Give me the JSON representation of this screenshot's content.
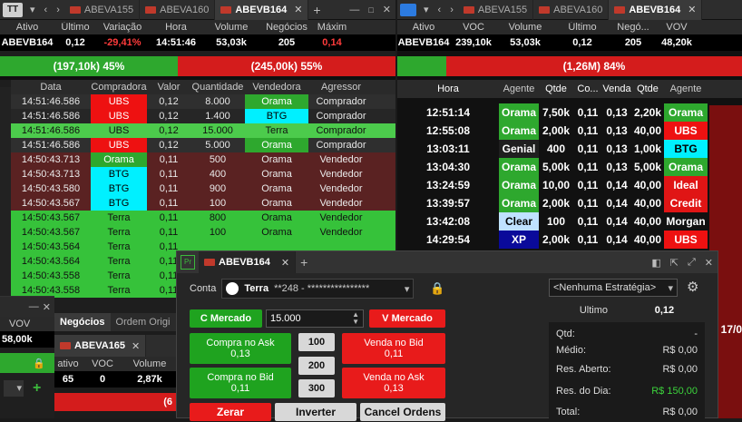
{
  "left_window": {
    "tabs": [
      {
        "label": "ABEVA155",
        "active": false
      },
      {
        "label": "ABEVA160",
        "active": false
      },
      {
        "label": "ABEVB164",
        "active": true
      }
    ],
    "quote_headers": [
      "Ativo",
      "Último",
      "Variação",
      "Hora",
      "Volume",
      "Negócios",
      "Máxim"
    ],
    "quote_values": [
      "ABEVB164",
      "0,12",
      "-29,41%",
      "14:51:46",
      "53,03k",
      "205",
      "0,14"
    ],
    "buy_pressure": "(197,10k) 45%",
    "sell_pressure": "(245,00k) 55%",
    "trade_headers": [
      "Data",
      "Compradora",
      "Valor",
      "Quantidade",
      "Vendedora",
      "Agressor"
    ],
    "trades": [
      {
        "data": "14:51:46.586",
        "comp": "UBS",
        "valor": "0,12",
        "qtd": "8.000",
        "vend": "Orama",
        "agr": "Comprador",
        "rowtype": "buy",
        "comp_style": "ubs",
        "vend_style": "orama"
      },
      {
        "data": "14:51:46.586",
        "comp": "UBS",
        "valor": "0,12",
        "qtd": "1.400",
        "vend": "BTG",
        "agr": "Comprador",
        "rowtype": "buy2",
        "comp_style": "ubs",
        "vend_style": "btg"
      },
      {
        "data": "14:51:46.586",
        "comp": "UBS",
        "valor": "0,12",
        "qtd": "15.000",
        "vend": "Terra",
        "agr": "Comprador",
        "rowtype": "terra2",
        "comp_style": "",
        "vend_style": ""
      },
      {
        "data": "14:51:46.586",
        "comp": "UBS",
        "valor": "0,12",
        "qtd": "5.000",
        "vend": "Orama",
        "agr": "Comprador",
        "rowtype": "buy",
        "comp_style": "ubs",
        "vend_style": "orama"
      },
      {
        "data": "14:50:43.713",
        "comp": "Orama",
        "valor": "0,11",
        "qtd": "500",
        "vend": "Orama",
        "agr": "Vendedor",
        "rowtype": "sell",
        "comp_style": "orama",
        "vend_style": ""
      },
      {
        "data": "14:50:43.713",
        "comp": "BTG",
        "valor": "0,11",
        "qtd": "400",
        "vend": "Orama",
        "agr": "Vendedor",
        "rowtype": "sell",
        "comp_style": "btg",
        "vend_style": ""
      },
      {
        "data": "14:50:43.580",
        "comp": "BTG",
        "valor": "0,11",
        "qtd": "900",
        "vend": "Orama",
        "agr": "Vendedor",
        "rowtype": "sell",
        "comp_style": "btg",
        "vend_style": ""
      },
      {
        "data": "14:50:43.567",
        "comp": "BTG",
        "valor": "0,11",
        "qtd": "100",
        "vend": "Orama",
        "agr": "Vendedor",
        "rowtype": "sell",
        "comp_style": "btg",
        "vend_style": ""
      },
      {
        "data": "14:50:43.567",
        "comp": "Terra",
        "valor": "0,11",
        "qtd": "800",
        "vend": "Orama",
        "agr": "Vendedor",
        "rowtype": "terra",
        "comp_style": "",
        "vend_style": ""
      },
      {
        "data": "14:50:43.567",
        "comp": "Terra",
        "valor": "0,11",
        "qtd": "100",
        "vend": "Orama",
        "agr": "Vendedor",
        "rowtype": "terra",
        "comp_style": "",
        "vend_style": ""
      },
      {
        "data": "14:50:43.564",
        "comp": "Terra",
        "valor": "0,11",
        "qtd": "",
        "vend": "",
        "agr": "",
        "rowtype": "terra",
        "comp_style": "",
        "vend_style": ""
      },
      {
        "data": "14:50:43.564",
        "comp": "Terra",
        "valor": "0,11",
        "qtd": "",
        "vend": "",
        "agr": "",
        "rowtype": "terra",
        "comp_style": "",
        "vend_style": ""
      },
      {
        "data": "14:50:43.558",
        "comp": "Terra",
        "valor": "0,11",
        "qtd": "",
        "vend": "",
        "agr": "",
        "rowtype": "terra",
        "comp_style": "",
        "vend_style": ""
      },
      {
        "data": "14:50:43.558",
        "comp": "Terra",
        "valor": "0,11",
        "qtd": "",
        "vend": "",
        "agr": "",
        "rowtype": "terra",
        "comp_style": "",
        "vend_style": ""
      }
    ]
  },
  "right_window": {
    "tabs": [
      {
        "label": "ABEVA155",
        "active": false
      },
      {
        "label": "ABEVA160",
        "active": false
      },
      {
        "label": "ABEVB164",
        "active": true
      }
    ],
    "quote_headers": [
      "Ativo",
      "VOC",
      "Volume",
      "Último",
      "Negó...",
      "VOV"
    ],
    "quote_values": [
      "ABEVB164",
      "239,10k",
      "53,03k",
      "0,12",
      "205",
      "48,20k"
    ],
    "pressure": "(1,26M) 84%",
    "book_headers": [
      "Hora",
      "Agente",
      "Qtde",
      "Co...",
      "Venda",
      "Qtde",
      "Agente"
    ],
    "book": [
      {
        "hora": "12:51:14",
        "ag": "Orama",
        "qt": "7,50k",
        "co": "0,11",
        "ve": "0,13",
        "qt2": "2,20k",
        "ag2": "Orama",
        "ag_style": "orama",
        "ag2_style": "orama"
      },
      {
        "hora": "12:55:08",
        "ag": "Orama",
        "qt": "2,00k",
        "co": "0,11",
        "ve": "0,13",
        "qt2": "40,00",
        "ag2": "UBS",
        "ag_style": "orama",
        "ag2_style": "ubs"
      },
      {
        "hora": "13:03:11",
        "ag": "Genial",
        "qt": "400",
        "co": "0,11",
        "ve": "0,13",
        "qt2": "1,00k",
        "ag2": "BTG",
        "ag_style": "genial",
        "ag2_style": "btg"
      },
      {
        "hora": "13:04:30",
        "ag": "Orama",
        "qt": "5,00k",
        "co": "0,11",
        "ve": "0,13",
        "qt2": "5,00k",
        "ag2": "Orama",
        "ag_style": "orama",
        "ag2_style": "orama"
      },
      {
        "hora": "13:24:59",
        "ag": "Orama",
        "qt": "10,00",
        "co": "0,11",
        "ve": "0,14",
        "qt2": "40,00",
        "ag2": "Ideal",
        "ag_style": "orama",
        "ag2_style": "ideal"
      },
      {
        "hora": "13:39:57",
        "ag": "Orama",
        "qt": "2,00k",
        "co": "0,11",
        "ve": "0,14",
        "qt2": "40,00",
        "ag2": "Credit",
        "ag_style": "orama",
        "ag2_style": "credit"
      },
      {
        "hora": "13:42:08",
        "ag": "Clear",
        "qt": "100",
        "co": "0,11",
        "ve": "0,14",
        "qt2": "40,00",
        "ag2": "Morgan",
        "ag_style": "clear",
        "ag2_style": "morgan"
      },
      {
        "hora": "14:29:54",
        "ag": "XP",
        "qt": "2,00k",
        "co": "0,11",
        "ve": "0,14",
        "qt2": "40,00",
        "ag2": "UBS",
        "ag_style": "xp",
        "ag2_style": "ubs"
      }
    ],
    "edge_label": "17/0"
  },
  "small_window": {
    "vov_label": "VOV",
    "vov_value": "58,00k",
    "tabs": [
      "Negócios",
      "Ordem Origi"
    ],
    "sub_tab": "ABEVA165",
    "sub_headers": [
      "ativo",
      "VOC",
      "Volume"
    ],
    "sub_values": [
      "65",
      "0",
      "2,87k"
    ],
    "sub_footer": "(6"
  },
  "order_window": {
    "tab_label": "ABEVB164",
    "conta_label": "Conta",
    "account_broker": "Terra",
    "account_number": "**248 - ****************",
    "strategy": "<Nenhuma Estratégia>",
    "c_mercado": "C Mercado",
    "quantity": "15.000",
    "v_mercado": "V Mercado",
    "compra_ask_label": "Compra no Ask",
    "compra_ask_price": "0,13",
    "venda_bid_label": "Venda no Bid",
    "venda_bid_price": "0,11",
    "compra_bid_label": "Compra no Bid",
    "compra_bid_price": "0,11",
    "venda_ask_label": "Venda no Ask",
    "venda_ask_price": "0,13",
    "qty_presets": [
      "100",
      "200",
      "300"
    ],
    "zerar": "Zerar",
    "inverter": "Inverter",
    "cancel_orders": "Cancel Ordens",
    "summary": {
      "ultimo_label": "Ultimo",
      "ultimo_value": "0,12",
      "qtd_label": "Qtd:",
      "qtd_value": "-",
      "medio_label": "Médio:",
      "medio_value": "R$ 0,00",
      "res_aberto_label": "Res. Aberto:",
      "res_aberto_value": "R$ 0,00",
      "res_dia_label": "Res. do Dia:",
      "res_dia_value": "R$ 150,00",
      "total_label": "Total:",
      "total_value": "R$ 0,00"
    }
  }
}
